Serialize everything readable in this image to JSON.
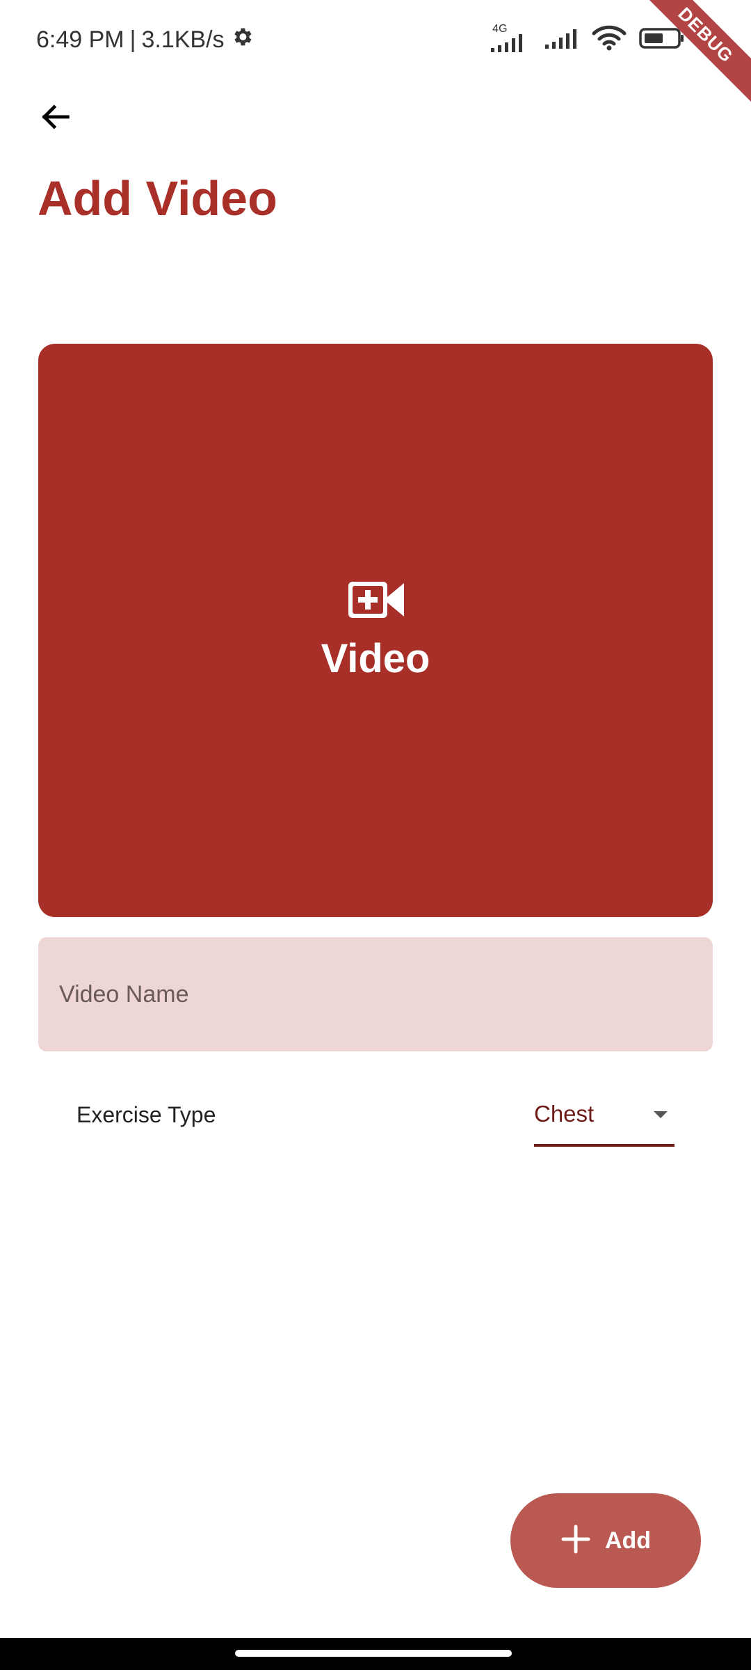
{
  "status_bar": {
    "time": "6:49 PM",
    "separator": "|",
    "speed": "3.1KB/s",
    "network": "4G",
    "battery": "52"
  },
  "debug_banner": "DEBUG",
  "header": {
    "title": "Add Video"
  },
  "video_picker": {
    "label": "Video"
  },
  "form": {
    "name_placeholder": "Video Name",
    "name_value": "",
    "exercise_type_label": "Exercise Type",
    "exercise_type_value": "Chest"
  },
  "fab": {
    "label": "Add"
  },
  "colors": {
    "primary": "#a83029",
    "field_background": "#edd6d5",
    "fab_background": "#b95952",
    "dropdown_accent": "#6e1c17"
  }
}
